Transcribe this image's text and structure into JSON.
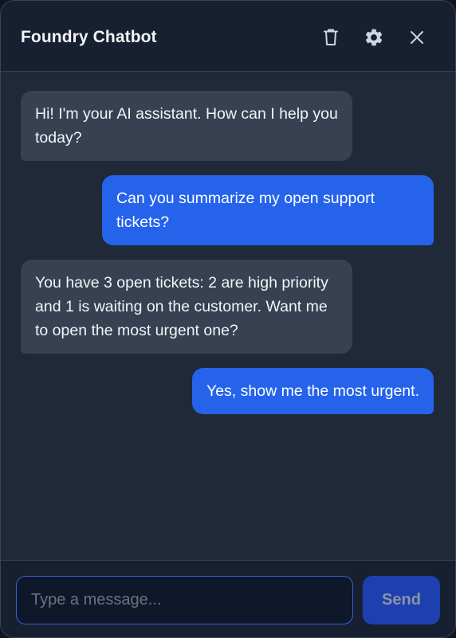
{
  "header": {
    "title": "Foundry Chatbot",
    "actions": [
      {
        "name": "delete",
        "icon": "trash-icon"
      },
      {
        "name": "settings",
        "icon": "gear-icon"
      },
      {
        "name": "close",
        "icon": "close-icon"
      }
    ]
  },
  "messages": [
    {
      "role": "bot",
      "text": "Hi! I'm your AI assistant. How can I help you today?"
    },
    {
      "role": "user",
      "text": "Can you summarize my open support tickets?"
    },
    {
      "role": "bot",
      "text": "You have 3 open tickets: 2 are high priority and 1 is waiting on the customer. Want me to open the most urgent one?"
    },
    {
      "role": "user",
      "text": "Yes, show me the most urgent."
    }
  ],
  "composer": {
    "placeholder": "Type a message...",
    "value": "",
    "send_label": "Send"
  },
  "colors": {
    "panel": "#1f2937",
    "header": "#172030",
    "bot_bubble": "#374151",
    "user_bubble": "#2563eb",
    "send_button": "#1e40af",
    "input_border": "#3b5fd6"
  }
}
